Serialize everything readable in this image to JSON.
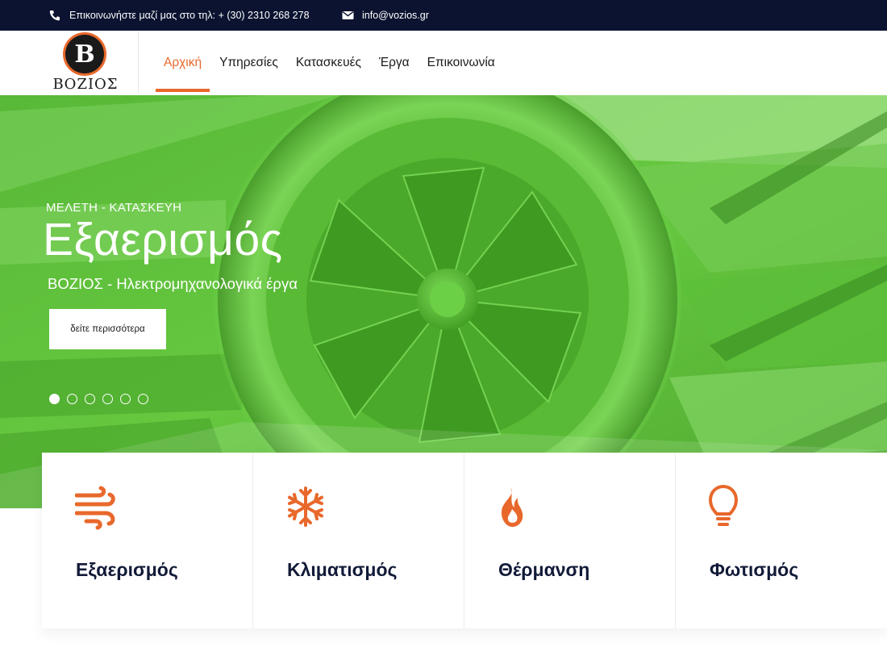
{
  "topbar": {
    "phone_text": "Επικοινωνήστε μαζί μας στο τηλ: + (30) 2310 268 278",
    "email_text": "info@vozios.gr",
    "phone_icon": "phone-icon",
    "email_icon": "envelope-icon"
  },
  "header": {
    "logo_letter": "B",
    "logo_text": "ΒΟΖΙΟΣ",
    "nav": [
      {
        "label": "Αρχική",
        "active": true
      },
      {
        "label": "Υπηρεσίες",
        "active": false
      },
      {
        "label": "Κατασκευές",
        "active": false
      },
      {
        "label": "Έργα",
        "active": false
      },
      {
        "label": "Επικοινωνία",
        "active": false
      }
    ]
  },
  "hero": {
    "subtitle": "ΜΕΛΕΤΗ - ΚΑΤΑΣΚΕΥΗ",
    "title": "Εξαερισμός",
    "tagline": "ΒΟΖΙΟΣ - Ηλεκτρομηχανολογικά έργα",
    "button_label": "δείτε περισσότερα",
    "slides_total": 6,
    "active_slide": 1
  },
  "services": [
    {
      "label": "Εξαερισμός",
      "icon": "wind-icon"
    },
    {
      "label": "Κλιματισμός",
      "icon": "snowflake-icon"
    },
    {
      "label": "Θέρμανση",
      "icon": "flame-icon"
    },
    {
      "label": "Φωτισμός",
      "icon": "lightbulb-icon"
    }
  ],
  "colors": {
    "accent": "#e8682b",
    "topbar_bg": "#0b1330",
    "hero_green": "#5fc43a",
    "heading_dark": "#121a38"
  }
}
